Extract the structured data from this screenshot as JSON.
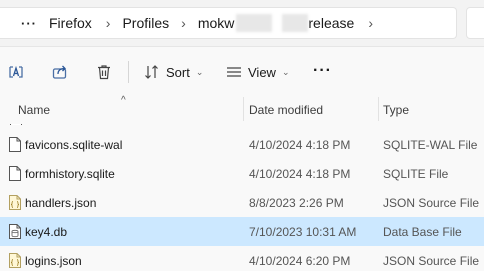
{
  "address_bar": {
    "more_label": "···",
    "crumbs": [
      "Firefox",
      "Profiles",
      "mokw",
      "release"
    ],
    "separator": "›"
  },
  "command_bar": {
    "sort_label": "Sort",
    "view_label": "View",
    "more_label": "···",
    "icons": [
      "copy-path-icon",
      "share-icon",
      "delete-icon",
      "sort-icon",
      "view-icon",
      "more-icon"
    ]
  },
  "columns": {
    "name": "Name",
    "date_modified": "Date modified",
    "type": "Type"
  },
  "files": [
    {
      "name": "favicons.sqlite-wal",
      "date": "4/10/2024 4:18 PM",
      "type": "SQLITE-WAL File",
      "icon": "blank-file-icon",
      "selected": false
    },
    {
      "name": "formhistory.sqlite",
      "date": "4/10/2024 4:18 PM",
      "type": "SQLITE File",
      "icon": "blank-file-icon",
      "selected": false
    },
    {
      "name": "handlers.json",
      "date": "8/8/2023 2:26 PM",
      "type": "JSON Source File",
      "icon": "json-file-icon",
      "selected": false
    },
    {
      "name": "key4.db",
      "date": "7/10/2023 10:31 AM",
      "type": "Data Base File",
      "icon": "database-file-icon",
      "selected": true
    },
    {
      "name": "logins.json",
      "date": "4/10/2024 6:20 PM",
      "type": "JSON Source File",
      "icon": "json-file-icon",
      "selected": false
    }
  ],
  "colors": {
    "selected_row": "#cce8ff",
    "accent": "#0067c0"
  }
}
